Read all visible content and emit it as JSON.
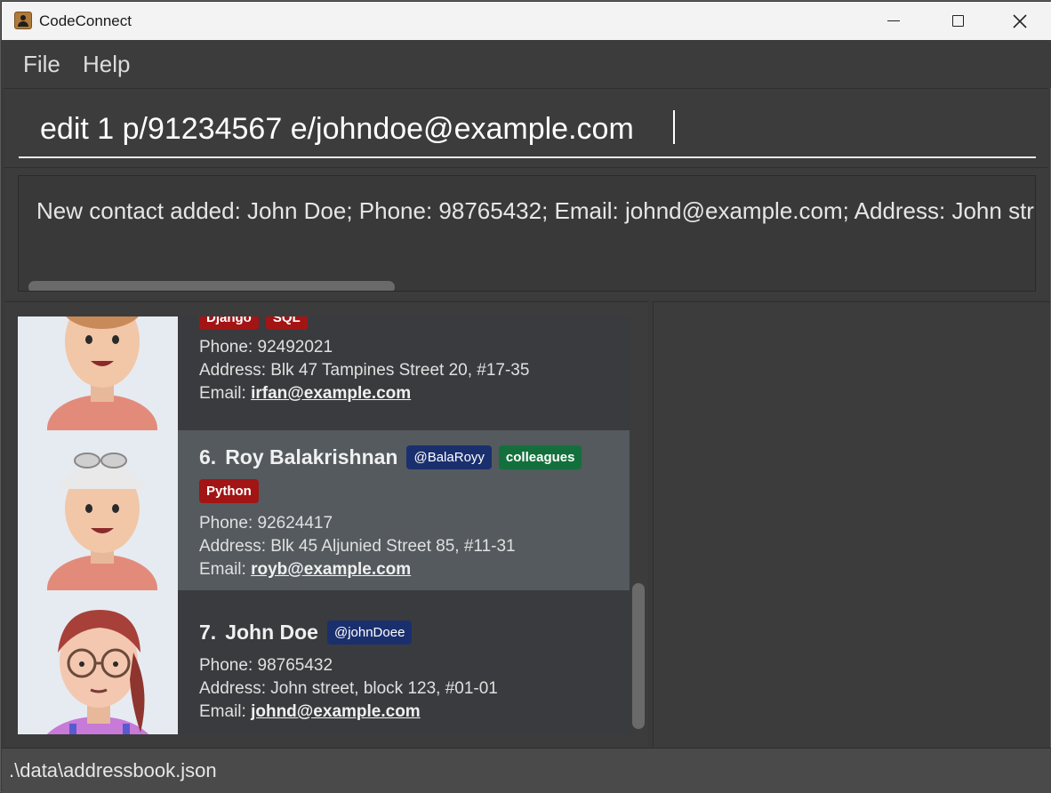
{
  "window": {
    "title": "CodeConnect"
  },
  "menu": {
    "file": "File",
    "help": "Help"
  },
  "command": {
    "value": "edit 1 p/91234567 e/johndoe@example.com"
  },
  "result": {
    "text": "New contact added: John Doe; Phone: 98765432; Email: johnd@example.com; Address: John str"
  },
  "contacts": [
    {
      "index": "",
      "name": "",
      "tags_partial": [
        "Django",
        "SQL"
      ],
      "phone": "Phone: 92492021",
      "address": "Address: Blk 47 Tampines Street 20, #17-35",
      "email_label": "Email:",
      "email": "irfan@example.com"
    },
    {
      "index": "6.",
      "name": "Roy Balakrishnan",
      "handle": "@BalaRoyy",
      "tags": [
        "colleagues",
        "Python"
      ],
      "phone": "Phone: 92624417",
      "address": "Address: Blk 45 Aljunied Street 85, #11-31",
      "email_label": "Email:",
      "email": "royb@example.com"
    },
    {
      "index": "7.",
      "name": "John Doe",
      "handle": "@johnDoee",
      "tags": [],
      "phone": "Phone: 98765432",
      "address": "Address: John street, block 123, #01-01",
      "email_label": "Email:",
      "email": "johnd@example.com"
    }
  ],
  "status": {
    "path": ".\\data\\addressbook.json"
  },
  "colors": {
    "tag_handle": "#1a2f6e",
    "tag_group": "#13703c",
    "tag_skill": "#a31414",
    "selected_card": "#545a5e"
  }
}
